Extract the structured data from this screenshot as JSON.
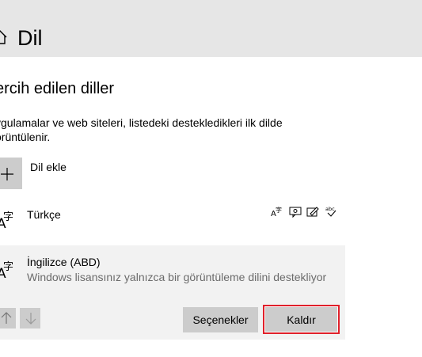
{
  "header": {
    "title": "Dil",
    "icon": "home-icon",
    "background": "#e6e6e6"
  },
  "section": {
    "title": "ercih edilen diller",
    "description_line1": "ygulamalar ve web siteleri, listedeki destekledikleri ilk dilde",
    "description_line2": "örüntülenir."
  },
  "add_language": {
    "label": "Dil ekle",
    "icon": "plus-icon"
  },
  "languages": [
    {
      "name": "Türkçe",
      "icon": "language-icon",
      "feature_icons": [
        "text-to-speech-icon",
        "speech-recognition-icon",
        "handwriting-icon",
        "spellcheck-icon"
      ]
    },
    {
      "name": "İngilizce (ABD)",
      "subtitle": "Windows lisansınız yalnızca bir görüntüleme dilini destekliyor",
      "icon": "language-icon",
      "selected": true
    }
  ],
  "actions": {
    "move_up_icon": "arrow-up-icon",
    "move_down_icon": "arrow-down-icon",
    "options_label": "Seçenekler",
    "remove_label": "Kaldır",
    "highlight_color": "#e0202a"
  }
}
